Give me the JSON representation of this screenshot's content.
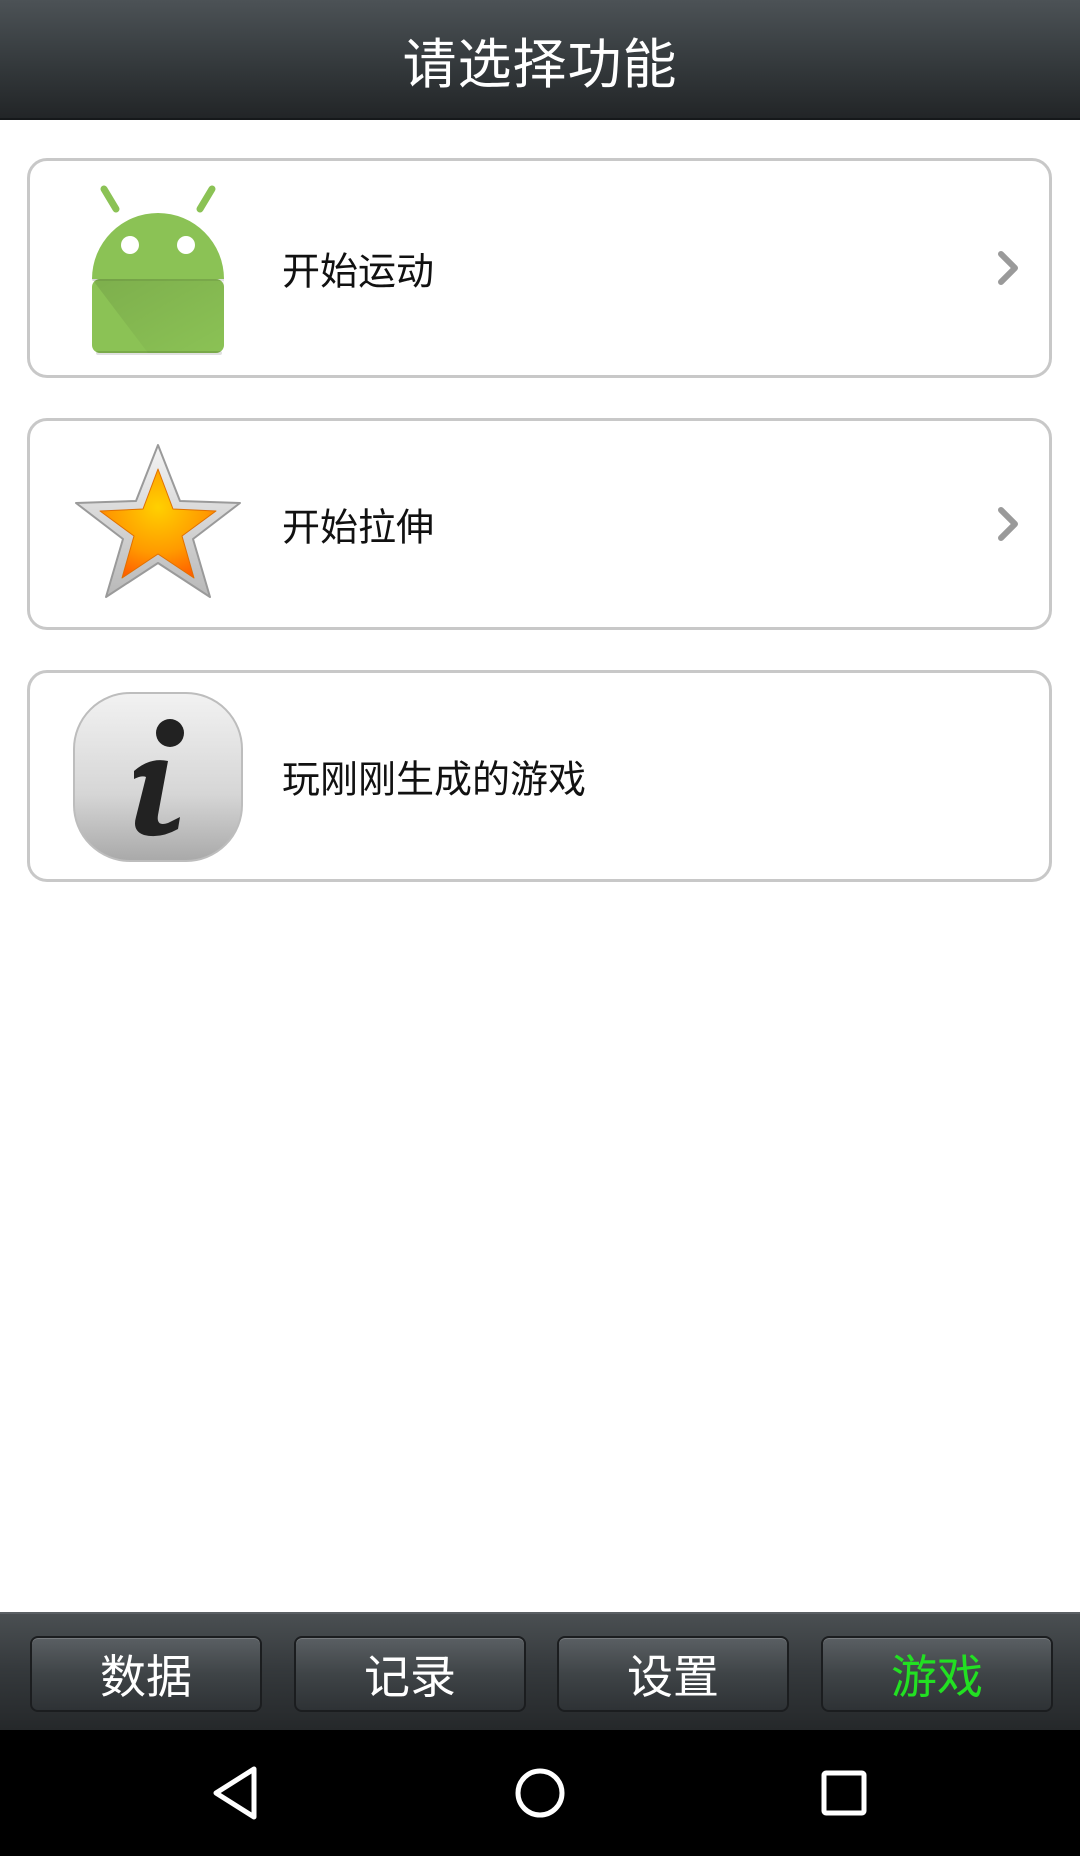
{
  "header": {
    "title": "请选择功能"
  },
  "menu": {
    "items": [
      {
        "label": "开始运动",
        "icon": "android-robot-icon",
        "has_chevron": true
      },
      {
        "label": "开始拉伸",
        "icon": "star-icon",
        "has_chevron": true
      },
      {
        "label": "玩刚刚生成的游戏",
        "icon": "info-icon",
        "has_chevron": false
      }
    ]
  },
  "tabbar": {
    "tabs": [
      {
        "label": "数据",
        "active": false
      },
      {
        "label": "记录",
        "active": false
      },
      {
        "label": "设置",
        "active": false
      },
      {
        "label": "游戏",
        "active": true
      }
    ],
    "active_color": "#22e022"
  },
  "system_nav": {
    "buttons": [
      "back-icon",
      "home-icon",
      "recents-icon"
    ]
  }
}
